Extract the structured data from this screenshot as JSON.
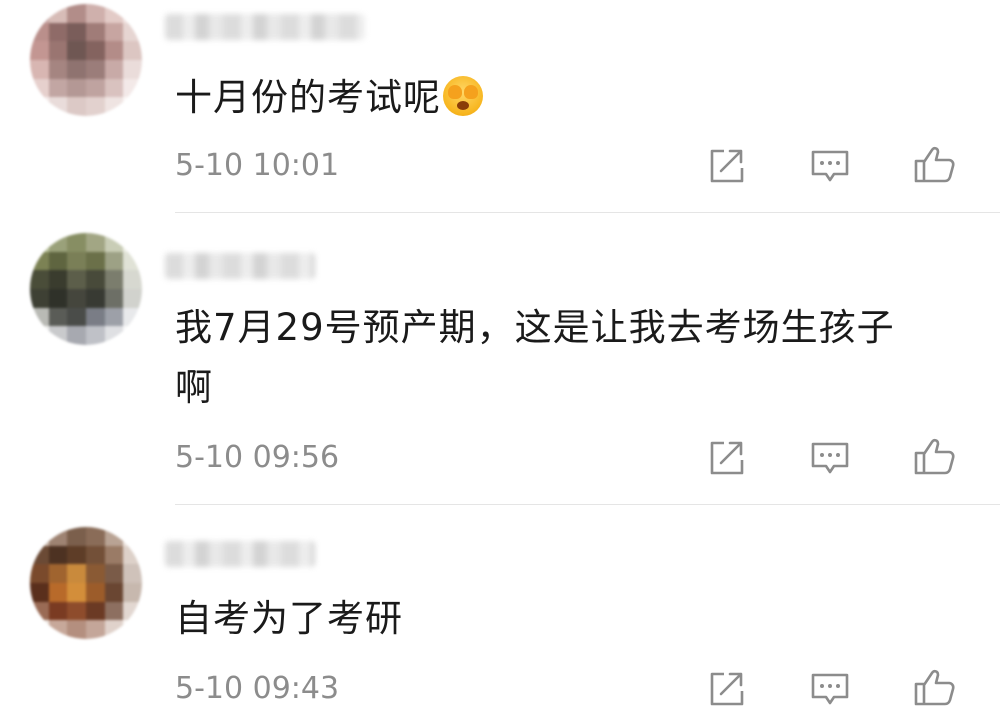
{
  "comments": [
    {
      "text": "十月份的考试呢",
      "emoji": "face-covering-eyes-emoji",
      "time": "5-10 10:01"
    },
    {
      "text_line1": "我7月29号预产期，这是让我去考场生孩子",
      "text_line2": "啊",
      "time": "5-10 09:56"
    },
    {
      "text": "自考为了考研",
      "time": "5-10 09:43"
    }
  ],
  "icons": {
    "share": "share-icon",
    "reply": "reply-icon",
    "like": "thumbs-up-icon"
  },
  "colors": {
    "text": "#1a1a1a",
    "timestamp": "#8c8c8c",
    "icon": "#8c8c8c",
    "divider": "#e5e5e5"
  }
}
